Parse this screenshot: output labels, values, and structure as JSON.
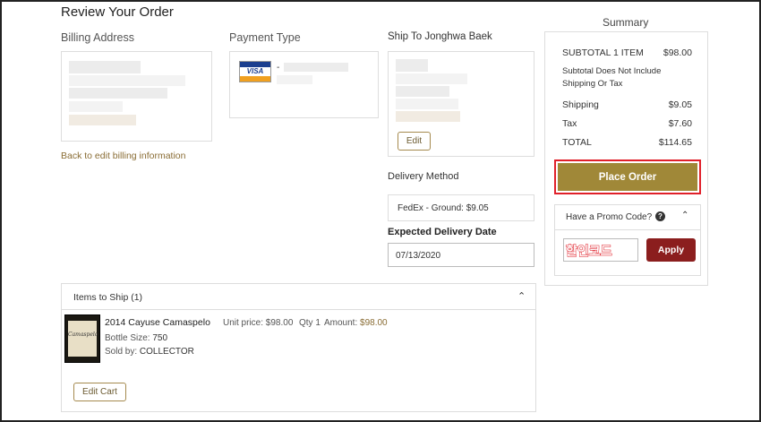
{
  "page": {
    "title": "Review Your Order"
  },
  "billing": {
    "label": "Billing Address",
    "back_link": "Back to edit billing information"
  },
  "payment": {
    "label": "Payment Type",
    "card_brand": "VISA",
    "card_mask": "-"
  },
  "shipping": {
    "label": "Ship To Jonghwa Baek",
    "edit_label": "Edit",
    "delivery_method_label": "Delivery Method",
    "delivery_method_value": "FedEx - Ground: $9.05",
    "expected_date_label": "Expected Delivery Date",
    "expected_date_value": "07/13/2020"
  },
  "items": {
    "header": "Items to Ship (1)",
    "list": [
      {
        "name": "2014 Cayuse Camaspelo",
        "unit_price": "Unit price: $98.00",
        "qty": "Qty 1",
        "amount_label": "Amount:",
        "amount_value": "$98.00",
        "bottle_size_label": "Bottle Size:",
        "bottle_size_value": "750",
        "sold_by_label": "Sold by:",
        "sold_by_value": "COLLECTOR",
        "thumb_text": "Camaspelo"
      }
    ],
    "edit_cart_label": "Edit Cart"
  },
  "summary": {
    "title": "Summary",
    "subtotal_label": "SUBTOTAL 1 ITEM",
    "subtotal_value": "$98.00",
    "note": "Subtotal Does Not Include Shipping Or Tax",
    "shipping_label": "Shipping",
    "shipping_value": "$9.05",
    "tax_label": "Tax",
    "tax_value": "$7.60",
    "total_label": "TOTAL",
    "total_value": "$114.65",
    "place_order_label": "Place Order",
    "promo_label": "Have a Promo Code?",
    "promo_input_value": "할인코드",
    "apply_label": "Apply"
  },
  "colors": {
    "gold": "#a08838",
    "apply": "#8b1e1e",
    "highlight": "#e0202a"
  }
}
